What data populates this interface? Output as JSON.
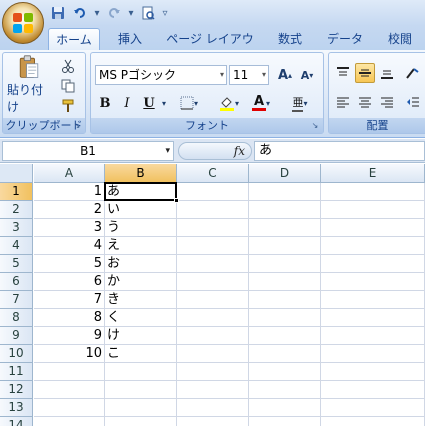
{
  "qat": {
    "save_icon": "save-icon",
    "undo_icon": "undo-icon",
    "redo_icon": "redo-icon",
    "preview_icon": "print-preview-icon",
    "customize": "▿"
  },
  "tabs": [
    {
      "label": "ホーム",
      "active": true
    },
    {
      "label": "挿入"
    },
    {
      "label": "ページ レイアウト"
    },
    {
      "label": "数式"
    },
    {
      "label": "データ"
    },
    {
      "label": "校閲"
    }
  ],
  "ribbon": {
    "clipboard": {
      "label": "クリップボード",
      "paste": "貼り付け"
    },
    "font": {
      "label": "フォント",
      "name": "MS Pゴシック",
      "size": "11",
      "bold": "B",
      "italic": "I",
      "underline": "U",
      "grow": "A",
      "shrink": "A",
      "color_letter": "A",
      "phonetic": "亜"
    },
    "alignment": {
      "label": "配置"
    }
  },
  "formula_bar": {
    "name_box": "B1",
    "fx": "fx",
    "content": "あ"
  },
  "sheet": {
    "columns": [
      "A",
      "B",
      "C",
      "D",
      "E"
    ],
    "selected_column": "B",
    "rows": [
      {
        "row": "1",
        "a": "1",
        "b": "あ"
      },
      {
        "row": "2",
        "a": "2",
        "b": "い"
      },
      {
        "row": "3",
        "a": "3",
        "b": "う"
      },
      {
        "row": "4",
        "a": "4",
        "b": "え"
      },
      {
        "row": "5",
        "a": "5",
        "b": "お"
      },
      {
        "row": "6",
        "a": "6",
        "b": "か"
      },
      {
        "row": "7",
        "a": "7",
        "b": "き"
      },
      {
        "row": "8",
        "a": "8",
        "b": "く"
      },
      {
        "row": "9",
        "a": "9",
        "b": "け"
      },
      {
        "row": "10",
        "a": "10",
        "b": "こ"
      },
      {
        "row": "11",
        "a": "",
        "b": ""
      },
      {
        "row": "12",
        "a": "",
        "b": ""
      },
      {
        "row": "13",
        "a": "",
        "b": ""
      },
      {
        "row": "14",
        "a": "",
        "b": ""
      }
    ],
    "selected_row": "1"
  }
}
